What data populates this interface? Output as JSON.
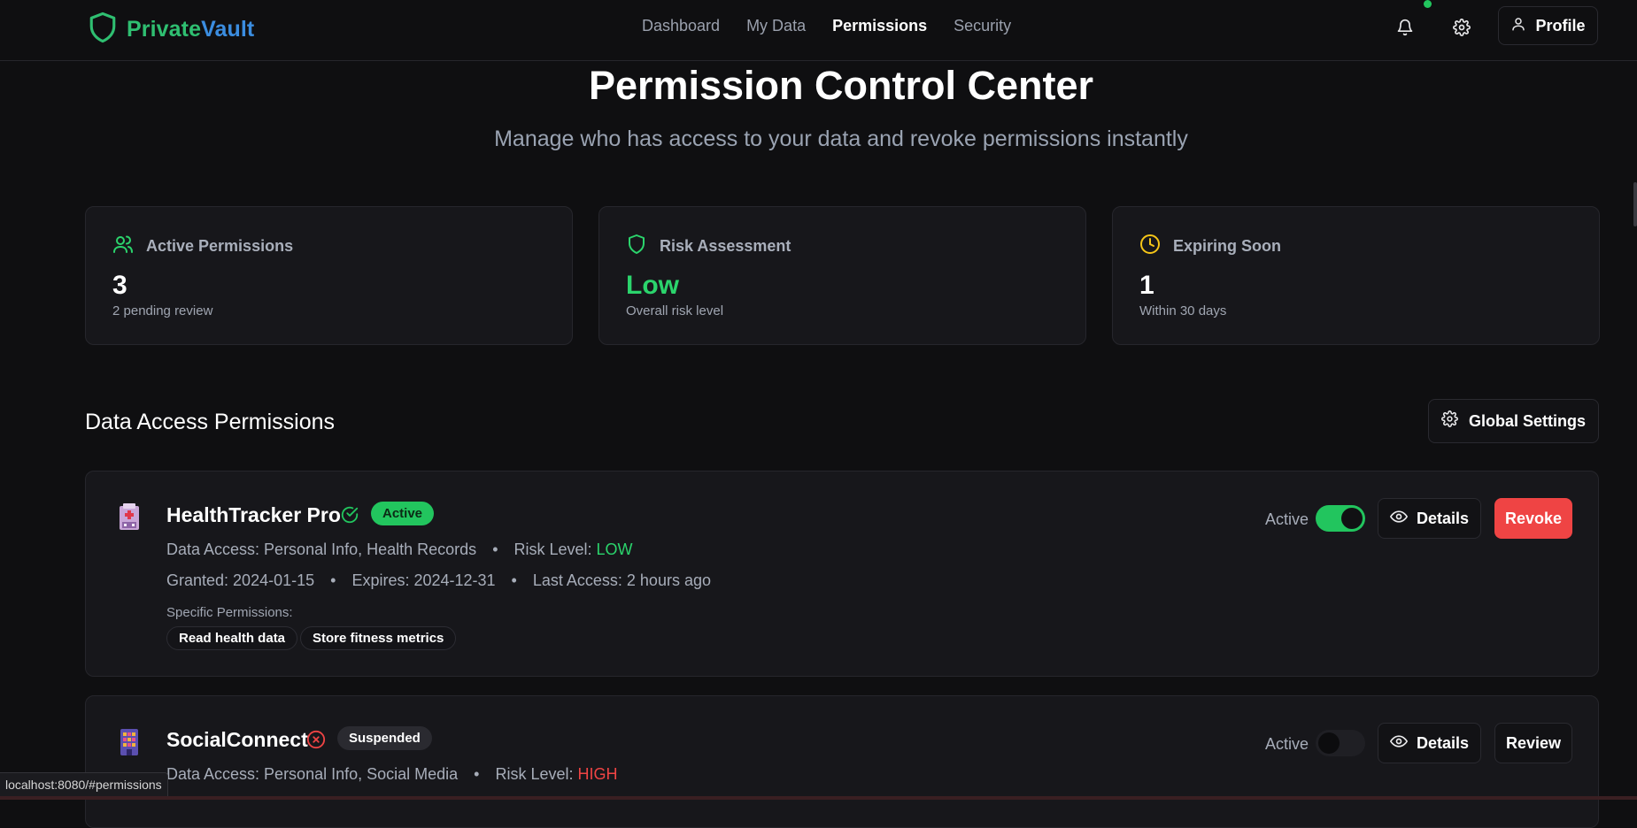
{
  "brand": {
    "name_part1": "Private",
    "name_part2": "Vault"
  },
  "nav": {
    "items": [
      {
        "label": "Dashboard",
        "active": false
      },
      {
        "label": "My Data",
        "active": false
      },
      {
        "label": "Permissions",
        "active": true
      },
      {
        "label": "Security",
        "active": false
      }
    ]
  },
  "header": {
    "profile_label": "Profile",
    "icons": [
      "bell-icon",
      "gear-icon",
      "user-icon"
    ]
  },
  "hero": {
    "title": "Permission Control Center",
    "subtitle": "Manage who has access to your data and revoke permissions instantly"
  },
  "stats": [
    {
      "title": "Active Permissions",
      "value": "3",
      "note": "2 pending review",
      "icon": "users-icon",
      "color": "#2bd46c"
    },
    {
      "title": "Risk Assessment",
      "value": "Low",
      "note": "Overall risk level",
      "icon": "shield-icon",
      "color": "#2bd46c"
    },
    {
      "title": "Expiring Soon",
      "value": "1",
      "note": "Within 30 days",
      "icon": "clock-icon",
      "color": "#f5c518"
    }
  ],
  "section": {
    "title": "Data Access Permissions",
    "global_settings_label": "Global Settings"
  },
  "permissions": [
    {
      "name": "HealthTracker Pro",
      "status": "Active",
      "data_access_label": "Data Access: Personal Info, Health Records",
      "risk_label": "Risk Level: ",
      "risk_value": "LOW",
      "granted": "Granted: 2024-01-15",
      "expires": "Expires: 2024-12-31",
      "last_access": "Last Access: 2 hours ago",
      "specific_label": "Specific Permissions:",
      "specific": [
        "Read health data",
        "Store fitness metrics"
      ],
      "toggle_label": "Active",
      "toggle_on": true,
      "details_label": "Details",
      "action_label": "Revoke"
    },
    {
      "name": "SocialConnect",
      "status": "Suspended",
      "data_access_label": "Data Access: Personal Info, Social Media",
      "risk_label": "Risk Level: ",
      "risk_value": "HIGH",
      "toggle_label": "Active",
      "toggle_on": false,
      "details_label": "Details",
      "action_label": "Review"
    }
  ],
  "statusbar": {
    "url": "localhost:8080/#permissions"
  },
  "colors": {
    "accent_green": "#22c55e",
    "danger_red": "#ef4444",
    "brand_blue": "#3b8de0",
    "warning_yellow": "#f5c518"
  }
}
